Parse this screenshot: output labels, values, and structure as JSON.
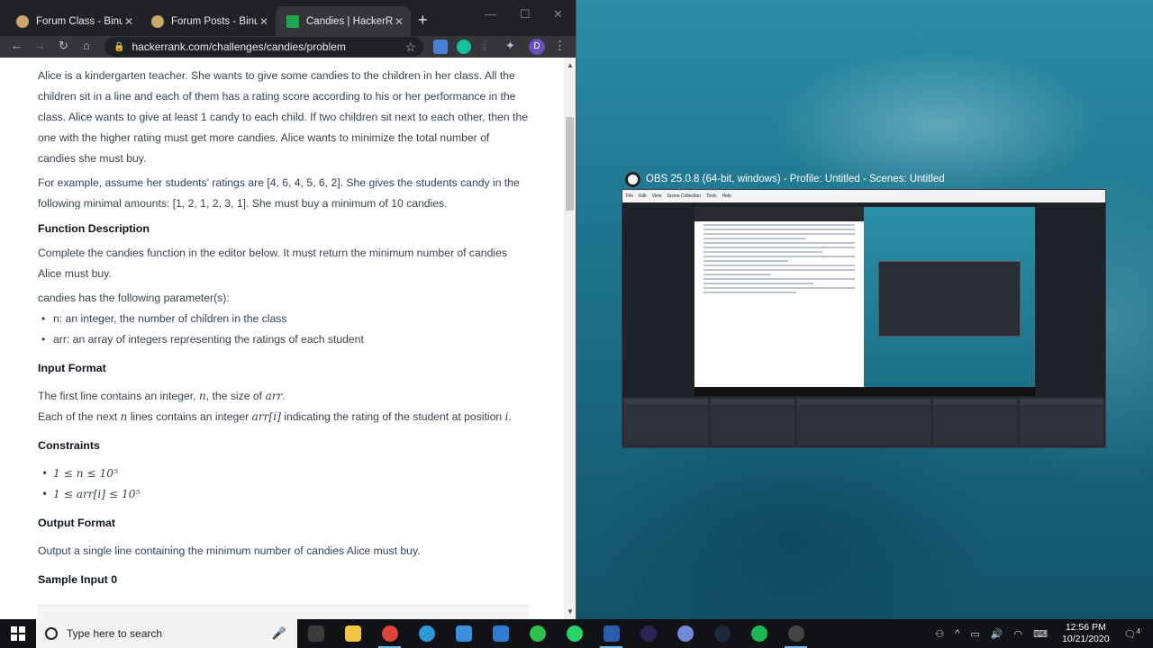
{
  "browser": {
    "tabs": [
      {
        "title": "Forum Class - Binusm",
        "active": false
      },
      {
        "title": "Forum Posts - Binusm",
        "active": false
      },
      {
        "title": "Candies | HackerRank",
        "active": true
      }
    ],
    "url": "hackerrank.com/challenges/candies/problem",
    "profile_initial": "D"
  },
  "problem": {
    "intro": "Alice is a kindergarten teacher. She wants to give some candies to the children in her class.  All the children sit in a line and each of them has a rating score according to his or her performance in the class.  Alice wants to give at least 1 candy to each child. If two children sit next to each other, then the one with the higher rating must get more candies. Alice wants to minimize the total number of candies she must buy.",
    "example": "For example, assume her students' ratings are [4, 6, 4, 5, 6, 2]. She gives the students candy in the following minimal amounts: [1, 2, 1, 2, 3, 1]. She must buy a minimum of 10 candies.",
    "function_heading": "Function Description",
    "function_desc": "Complete the candies function in the editor below. It must return the minimum number of candies Alice must buy.",
    "params_intro": "candies has the following parameter(s):",
    "params": [
      "n: an integer, the number of children in the class",
      "arr: an array of integers representing the ratings of each student"
    ],
    "input_heading": "Input Format",
    "input_line1_a": "The first line contains an integer, ",
    "input_line1_var": "n",
    "input_line1_b": ", the size of ",
    "input_line1_var2": "arr",
    "input_line1_c": ".",
    "input_line2_a": "Each of the next ",
    "input_line2_var": "n",
    "input_line2_b": " lines contains an integer ",
    "input_line2_var2": "arr[i]",
    "input_line2_c": " indicating the rating of the student at position ",
    "input_line2_var3": "i",
    "input_line2_d": ".",
    "constraints_heading": "Constraints",
    "constraints": [
      "1 ≤ n ≤ 10⁵",
      "1 ≤ arr[i] ≤ 10⁵"
    ],
    "output_heading": "Output Format",
    "output_desc": "Output a single line containing the minimum number of candies Alice must buy.",
    "sample_heading": "Sample Input 0"
  },
  "obs": {
    "title": "OBS 25.0.8 (64-bit, windows) - Profile: Untitled - Scenes: Untitled",
    "menu": [
      "File",
      "Edit",
      "View",
      "Scene Collection",
      "Tools",
      "Help"
    ]
  },
  "taskbar": {
    "search_placeholder": "Type here to search",
    "apps": [
      {
        "name": "task-view",
        "color": "#3a3a3a",
        "running": false
      },
      {
        "name": "file-explorer",
        "color": "#f4c542",
        "running": false
      },
      {
        "name": "chrome",
        "color": "#db4437",
        "running": true
      },
      {
        "name": "edge",
        "color": "#2c9ad6",
        "running": false
      },
      {
        "name": "store",
        "color": "#3b8fd8",
        "running": false
      },
      {
        "name": "mail",
        "color": "#2f7bd6",
        "running": false
      },
      {
        "name": "line",
        "color": "#2fc24a",
        "running": false
      },
      {
        "name": "whatsapp",
        "color": "#25d366",
        "running": false
      },
      {
        "name": "dev-cpp",
        "color": "#2a5db0",
        "running": true
      },
      {
        "name": "eclipse",
        "color": "#2c2255",
        "running": false
      },
      {
        "name": "discord",
        "color": "#7289da",
        "running": false
      },
      {
        "name": "steam",
        "color": "#1b2838",
        "running": false
      },
      {
        "name": "spotify",
        "color": "#1db954",
        "running": false
      },
      {
        "name": "obs",
        "color": "#444444",
        "running": true
      }
    ],
    "time": "12:56 PM",
    "date": "10/21/2020",
    "notification_count": "4"
  }
}
